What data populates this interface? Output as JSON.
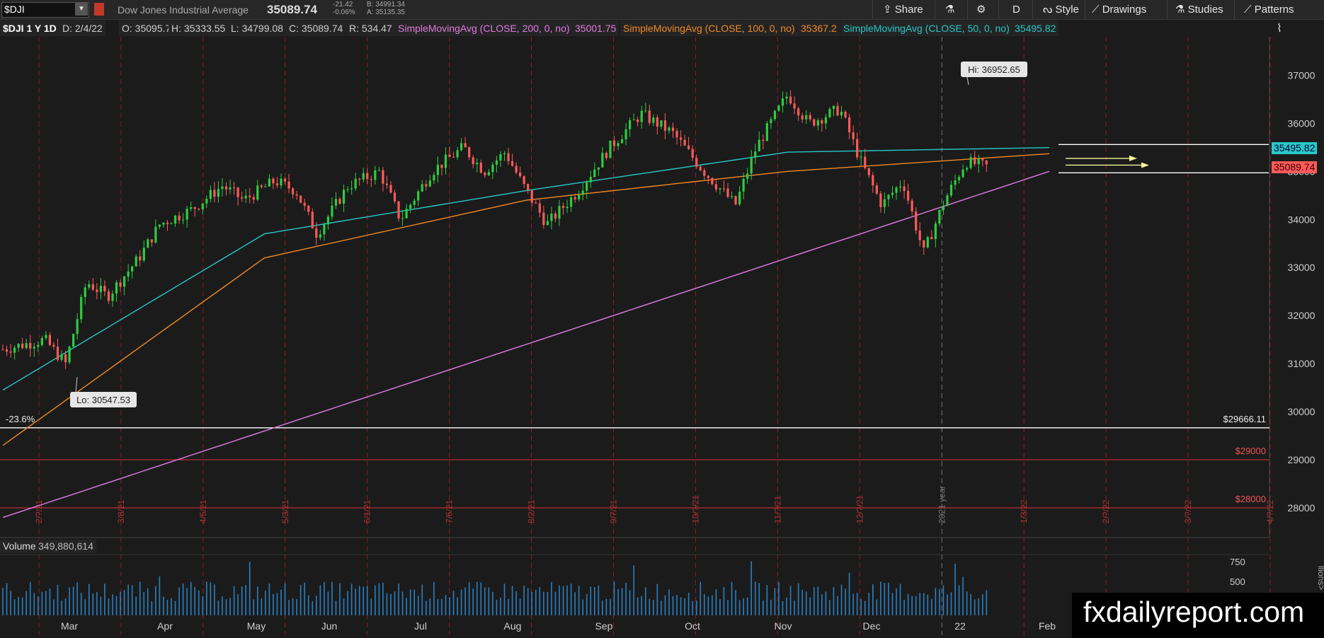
{
  "topbar": {
    "symbol": "$DJI",
    "symbol_dropdown_icon": "chevron-down-icon",
    "instrument_name": "Dow Jones Industrial Average",
    "last_price": "35089.74",
    "change": "-21.42",
    "change_pct": "-0.06%",
    "bid": "B: 34991.34",
    "ask": "A: 35135.35",
    "share_label": "Share",
    "share_icon": "share-icon",
    "flask_icon": "flask-icon",
    "gear_icon": "gear-icon",
    "aggregation": "D",
    "style_label": "Style",
    "drawings_label": "Drawings",
    "studies_label": "Studies",
    "patterns_label": "Patterns"
  },
  "infobar": {
    "symbol_period": "$DJI 1 Y 1D",
    "date": "D: 2/4/22",
    "open": "O: 35095.74",
    "high": "H: 35333.55",
    "low": "L: 34799.08",
    "close": "C: 35089.74",
    "range": "R: 534.47",
    "sma200_label": "SimpleMovingAvg (CLOSE, 200, 0, no)",
    "sma200_value": "35001.75",
    "sma100_label": "SimpleMovingAvg (CLOSE, 100, 0, no)",
    "sma100_value": "35367.2",
    "sma50_label": "SimpleMovingAvg (CLOSE, 50, 0, no)",
    "sma50_value": "35495.82"
  },
  "colors": {
    "background": "#1b1b1b",
    "up_candle": "#2ecc40",
    "down_candle": "#ff5a5a",
    "sma200": "#e07ce0",
    "sma100": "#f08a24",
    "sma50": "#28c8c8",
    "volume": "#2a7fc0",
    "grid_dashed": "#8a1f1f"
  },
  "chart_data": {
    "type": "candlestick",
    "y_axis_ticks": [
      37000,
      36000,
      35000,
      34000,
      33000,
      32000,
      31000,
      30000,
      29000,
      28000
    ],
    "y_range": [
      27500,
      37800
    ],
    "x_month_labels": [
      "Mar",
      "Apr",
      "May",
      "Jun",
      "Jul",
      "Aug",
      "Sep",
      "Oct",
      "Nov",
      "Dec",
      "22",
      "Feb"
    ],
    "vertical_date_markers": [
      "2/?/21",
      "3/8/21",
      "4/5/21",
      "5/3/21",
      "6/1/21",
      "7/6/21",
      "8/2/21",
      "9/7/21",
      "10/?/21",
      "11/?/21",
      "12/?/21",
      "2021 year",
      "1/3/22",
      "2/?/22",
      "3/?/22",
      "4/?/22"
    ],
    "high_annotation": "Hi: 36952.65",
    "low_annotation": "Lo: 30547.53",
    "price_levels": [
      {
        "label": "-23.6%",
        "price": 29666.11,
        "price_label": "$29666.11"
      },
      {
        "price": 29000,
        "price_label": "$29000"
      },
      {
        "price": 28000,
        "price_label": "$28000"
      }
    ],
    "price_tags": [
      {
        "label": "35495.82",
        "price": 35495.82
      },
      {
        "label": "35089.74",
        "price": 35089.74
      }
    ],
    "sma200": [
      [
        0,
        27800
      ],
      [
        1,
        35000
      ]
    ],
    "sma100": [
      [
        0,
        29300
      ],
      [
        0.25,
        33200
      ],
      [
        0.5,
        34400
      ],
      [
        0.75,
        35000
      ],
      [
        1,
        35367
      ]
    ],
    "sma50": [
      [
        0,
        30450
      ],
      [
        0.25,
        33700
      ],
      [
        0.5,
        34600
      ],
      [
        0.75,
        35400
      ],
      [
        1,
        35495
      ]
    ],
    "close_path": [
      [
        0,
        31300
      ],
      [
        0.04,
        31500
      ],
      [
        0.06,
        31000
      ],
      [
        0.08,
        32700
      ],
      [
        0.1,
        32400
      ],
      [
        0.13,
        33200
      ],
      [
        0.15,
        33900
      ],
      [
        0.18,
        34200
      ],
      [
        0.21,
        34700
      ],
      [
        0.23,
        34400
      ],
      [
        0.26,
        34800
      ],
      [
        0.28,
        34600
      ],
      [
        0.3,
        33700
      ],
      [
        0.33,
        34700
      ],
      [
        0.36,
        35000
      ],
      [
        0.38,
        34000
      ],
      [
        0.41,
        35000
      ],
      [
        0.44,
        35500
      ],
      [
        0.46,
        35000
      ],
      [
        0.48,
        35400
      ],
      [
        0.5,
        34600
      ],
      [
        0.52,
        33900
      ],
      [
        0.55,
        34600
      ],
      [
        0.58,
        35500
      ],
      [
        0.61,
        36200
      ],
      [
        0.64,
        35800
      ],
      [
        0.67,
        35000
      ],
      [
        0.7,
        34300
      ],
      [
        0.72,
        35500
      ],
      [
        0.75,
        36600
      ],
      [
        0.77,
        36000
      ],
      [
        0.8,
        36300
      ],
      [
        0.82,
        35200
      ],
      [
        0.84,
        34300
      ],
      [
        0.86,
        34800
      ],
      [
        0.88,
        33300
      ],
      [
        0.9,
        34400
      ],
      [
        0.92,
        35200
      ],
      [
        0.94,
        35100
      ]
    ],
    "volume_axis_ticks": [
      750,
      500
    ],
    "volume_axis_label": "llions>"
  },
  "volume": {
    "label": "Volume",
    "value": "349,880,614"
  },
  "watermark": {
    "text": "fxdailyreport.com"
  }
}
